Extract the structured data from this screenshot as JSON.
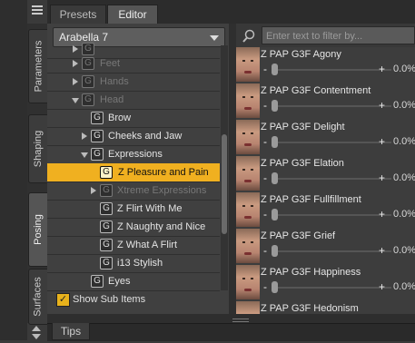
{
  "side_tabs": [
    "Parameters",
    "Shaping",
    "Posing",
    "Surfaces"
  ],
  "top_tabs": [
    "Presets",
    "Editor"
  ],
  "figure_select": {
    "value": "Arabella 7"
  },
  "tree": {
    "items": [
      {
        "label": "Feet"
      },
      {
        "label": "Hands"
      },
      {
        "label": "Head"
      },
      {
        "label": "Brow"
      },
      {
        "label": "Cheeks and Jaw"
      },
      {
        "label": "Expressions"
      },
      {
        "label": "Z Pleasure and Pain"
      },
      {
        "label": "Xtreme Expressions"
      },
      {
        "label": "Z Flirt With Me"
      },
      {
        "label": "Z Naughty and Nice"
      },
      {
        "label": "Z What A Flirt"
      },
      {
        "label": "i13 Stylish"
      },
      {
        "label": "Eyes"
      }
    ],
    "group_glyph": "G",
    "show_sub_items_label": "Show Sub Items",
    "show_sub_items_checked": true
  },
  "filter": {
    "placeholder": "Enter text to filter by..."
  },
  "morphs": [
    {
      "name": "Z PAP G3F Agony",
      "value": "0.0%"
    },
    {
      "name": "Z PAP G3F Contentment",
      "value": "0.0%"
    },
    {
      "name": "Z PAP G3F Delight",
      "value": "0.0%"
    },
    {
      "name": "Z PAP G3F Elation",
      "value": "0.0%"
    },
    {
      "name": "Z PAP G3F Fullfillment",
      "value": "0.0%"
    },
    {
      "name": "Z PAP G3F Grief",
      "value": "0.0%"
    },
    {
      "name": "Z PAP G3F Happiness",
      "value": "0.0%"
    },
    {
      "name": "Z PAP G3F Hedonism",
      "value": ""
    }
  ],
  "slider_symbols": {
    "minus": "-",
    "plus": "+"
  },
  "bottom": {
    "tips_label": "Tips"
  },
  "colors": {
    "selected_row": "#f0b020",
    "checkbox": "#e8b21c"
  }
}
